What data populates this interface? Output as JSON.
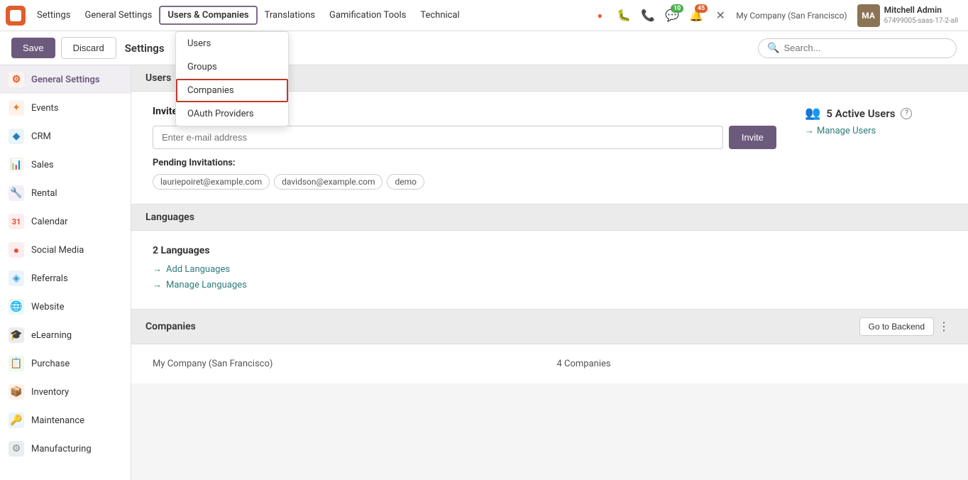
{
  "topnav": {
    "logo_alt": "Odoo Logo",
    "items": [
      {
        "id": "settings",
        "label": "Settings",
        "active": false
      },
      {
        "id": "general-settings",
        "label": "General Settings",
        "active": false
      },
      {
        "id": "users-companies",
        "label": "Users & Companies",
        "active": true
      },
      {
        "id": "translations",
        "label": "Translations",
        "active": false
      },
      {
        "id": "gamification-tools",
        "label": "Gamification Tools",
        "active": false
      },
      {
        "id": "technical",
        "label": "Technical",
        "active": false
      }
    ],
    "icons": [
      {
        "id": "red-dot",
        "symbol": "●",
        "color": "#e05e2b",
        "badge": null
      },
      {
        "id": "bug",
        "symbol": "🐛",
        "badge": null
      },
      {
        "id": "phone",
        "symbol": "📞",
        "badge": null
      },
      {
        "id": "chat",
        "symbol": "💬",
        "badge": "10",
        "badge_color": "green"
      },
      {
        "id": "activity",
        "symbol": "🔔",
        "badge": "45",
        "badge_color": "orange"
      },
      {
        "id": "close",
        "symbol": "✕",
        "badge": null
      }
    ],
    "company": "My Company (San Francisco)",
    "user": {
      "name": "Mitchell Admin",
      "id": "67499005-saas-17-2-all",
      "avatar_text": "MA"
    }
  },
  "toolbar": {
    "save_label": "Save",
    "discard_label": "Discard",
    "title": "Settings",
    "search_placeholder": "Search..."
  },
  "sidebar": {
    "items": [
      {
        "id": "general-settings",
        "label": "General Settings",
        "icon": "⚙",
        "icon_color": "#e05e2b",
        "active": true
      },
      {
        "id": "events",
        "label": "Events",
        "icon": "✕",
        "icon_color": "#e67e22"
      },
      {
        "id": "crm",
        "label": "CRM",
        "icon": "◆",
        "icon_color": "#2980b9"
      },
      {
        "id": "sales",
        "label": "Sales",
        "icon": "📊",
        "icon_color": "#e74c3c"
      },
      {
        "id": "rental",
        "label": "Rental",
        "icon": "🔧",
        "icon_color": "#9b59b6"
      },
      {
        "id": "calendar",
        "label": "Calendar",
        "icon": "31",
        "icon_color": "#e74c3c"
      },
      {
        "id": "social-media",
        "label": "Social Media",
        "icon": "●",
        "icon_color": "#e74c3c"
      },
      {
        "id": "referrals",
        "label": "Referrals",
        "icon": "◈",
        "icon_color": "#3498db"
      },
      {
        "id": "website",
        "label": "Website",
        "icon": "🌐",
        "icon_color": "#16a085"
      },
      {
        "id": "elearning",
        "label": "eLearning",
        "icon": "🎓",
        "icon_color": "#2c3e50"
      },
      {
        "id": "purchase",
        "label": "Purchase",
        "icon": "📋",
        "icon_color": "#27ae60"
      },
      {
        "id": "inventory",
        "label": "Inventory",
        "icon": "📦",
        "icon_color": "#e67e22"
      },
      {
        "id": "maintenance",
        "label": "Maintenance",
        "icon": "🔑",
        "icon_color": "#3498db"
      },
      {
        "id": "manufacturing",
        "label": "Manufacturing",
        "icon": "⚙",
        "icon_color": "#7f8c8d"
      }
    ]
  },
  "dropdown": {
    "items": [
      {
        "id": "users",
        "label": "Users",
        "highlighted": false
      },
      {
        "id": "groups",
        "label": "Groups",
        "highlighted": false
      },
      {
        "id": "companies",
        "label": "Companies",
        "highlighted": true
      },
      {
        "id": "oauth-providers",
        "label": "OAuth Providers",
        "highlighted": false
      }
    ]
  },
  "main": {
    "users_section": {
      "header": "Users",
      "invite_title": "Invite New Users",
      "invite_placeholder": "Enter e-mail address",
      "invite_button": "Invite",
      "pending_label": "Pending Invitations:",
      "pending_tags": [
        "lauriepoiret@example.com",
        "davidson@example.com",
        "demo"
      ],
      "active_users_count": "5 Active Users",
      "manage_users_label": "Manage Users",
      "help_title": "Help"
    },
    "languages_section": {
      "header": "Languages",
      "count": "2 Languages",
      "add_link": "Add Languages",
      "manage_link": "Manage Languages"
    },
    "companies_section": {
      "header": "Companies",
      "go_to_backend": "Go to Backend",
      "more_symbol": "⋮",
      "company_name": "My Company (San Francisco)",
      "companies_count": "4 Companies"
    }
  }
}
